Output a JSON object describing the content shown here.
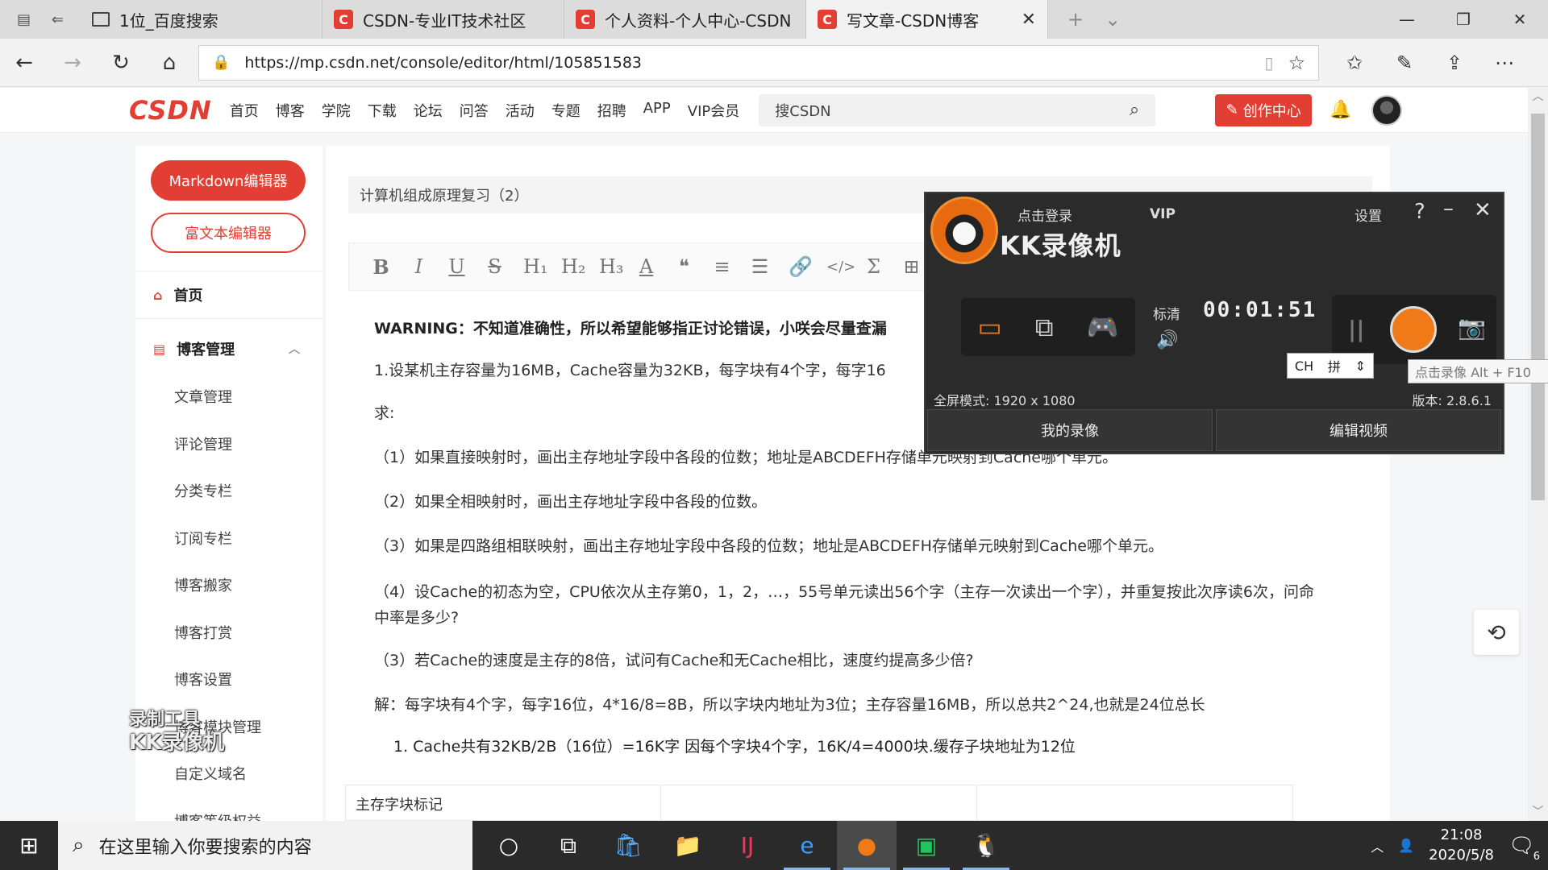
{
  "browser": {
    "tabs": [
      {
        "title": "1位_百度搜索",
        "icon": "page-icon"
      },
      {
        "title": "CSDN-专业IT技术社区",
        "icon": "csdn-icon"
      },
      {
        "title": "个人资料-个人中心-CSDN",
        "icon": "csdn-icon"
      },
      {
        "title": "写文章-CSDN博客",
        "icon": "csdn-icon",
        "active": true
      }
    ],
    "csdn_favicon": "C",
    "url": "https://mp.csdn.net/console/editor/html/105851583"
  },
  "csdn": {
    "logo": "CSDN",
    "nav": [
      "首页",
      "博客",
      "学院",
      "下载",
      "论坛",
      "问答",
      "活动",
      "专题",
      "招聘",
      "APP",
      "VIP会员"
    ],
    "search_placeholder": "搜CSDN",
    "create_label": "创作中心",
    "brand_color": "#e33e33"
  },
  "sidebar": {
    "markdown_btn": "Markdown编辑器",
    "richtext_btn": "富文本编辑器",
    "home": "首页",
    "group": "博客管理",
    "items": [
      "文章管理",
      "评论管理",
      "分类专栏",
      "订阅专栏",
      "博客搬家",
      "博客打赏",
      "博客设置",
      "博客模块管理",
      "自定义域名",
      "博客等级权益"
    ]
  },
  "editor": {
    "title": "计算机组成原理复习（2）",
    "toolbar": [
      "B",
      "I",
      "U",
      "S",
      "H₁",
      "H₂",
      "H₃",
      "A",
      "❝",
      "≡",
      "☰",
      "🔗",
      "</>",
      "Σ",
      "⊞"
    ],
    "paragraphs": [
      "WARNING：不知道准确性，所以希望能够指正讨论错误，小咲会尽量查漏",
      "1.设某机主存容量为16MB，Cache容量为32KB，每字块有4个字，每字16",
      "求:",
      "（1）如果直接映射时，画出主存地址字段中各段的位数；地址是ABCDEFH存储单元映射到Cache哪个单元。",
      "（2）如果全相映射时，画出主存地址字段中各段的位数。",
      "（3）如果是四路组相联映射，画出主存地址字段中各段的位数；地址是ABCDEFH存储单元映射到Cache哪个单元。",
      "（4）设Cache的初态为空，CPU依次从主存第0，1，2，…，55号单元读出56个字（主存一次读出一个字），并重复按此次序读6次，问命中率是多少?",
      "（3）若Cache的速度是主存的8倍，试问有Cache和无Cache相比，速度约提高多少倍?",
      "解：每字块有4个字，每字16位，4*16/8=8B，所以字块内地址为3位；主存容量16MB，所以总共2^24,也就是24位总长",
      "1.  Cache共有32KB/2B（16位）=16K字 因每个字块4个字，16K/4=4000块.缓存子块地址为12位"
    ],
    "table_cells": [
      "主存字块标记",
      "",
      ""
    ]
  },
  "watermark": {
    "line1": "录制工具",
    "line2": "KK录像机"
  },
  "kk": {
    "login": "点击登录",
    "vip": "VIP",
    "brand": "KK录像机",
    "settings": "设置",
    "quality": "标清",
    "timer": "00:01:51",
    "ime_lang": "CH",
    "ime_mode": "拼",
    "tooltip": "点击录像 Alt + F10",
    "fullscreen_label": "全屏模式:",
    "fullscreen_res": "1920 x 1080",
    "version_label": "版本:",
    "version": "2.8.6.1",
    "my_recordings": "我的录像",
    "edit_video": "编辑视频",
    "accent_color": "#f07a18"
  },
  "taskbar": {
    "search_placeholder": "在这里输入你要搜索的内容",
    "time": "21:08",
    "date": "2020/5/8",
    "notification_count": "6"
  }
}
